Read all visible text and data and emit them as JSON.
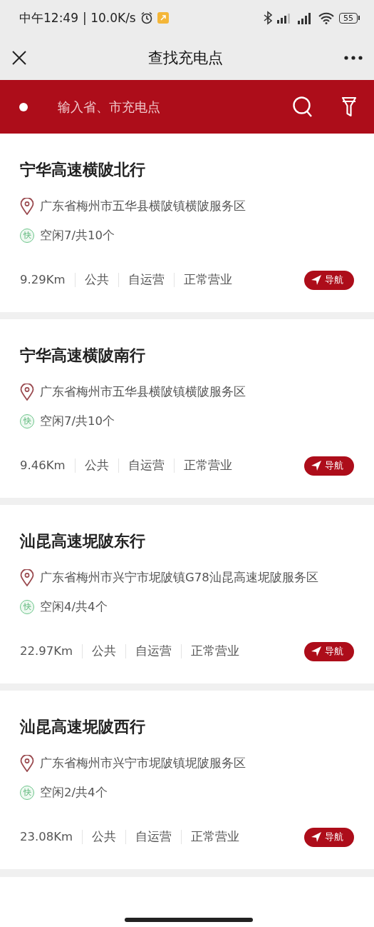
{
  "status_bar": {
    "time": "中午12:49",
    "speed": "| 10.0K/s",
    "battery": "55"
  },
  "header": {
    "title": "查找充电点"
  },
  "search": {
    "placeholder": "输入省、市充电点"
  },
  "stations": [
    {
      "name": "宁华高速横陂北行",
      "address": "广东省梅州市五华县横陂镇横陂服务区",
      "badge": "快",
      "availability": "空闲7/共10个",
      "distance": "9.29Km",
      "tags": [
        "公共",
        "自运营",
        "正常营业"
      ],
      "nav_label": "导航"
    },
    {
      "name": "宁华高速横陂南行",
      "address": "广东省梅州市五华县横陂镇横陂服务区",
      "badge": "快",
      "availability": "空闲7/共10个",
      "distance": "9.46Km",
      "tags": [
        "公共",
        "自运营",
        "正常营业"
      ],
      "nav_label": "导航"
    },
    {
      "name": "汕昆高速坭陂东行",
      "address": "广东省梅州市兴宁市坭陂镇G78汕昆高速坭陂服务区",
      "badge": "快",
      "availability": "空闲4/共4个",
      "distance": "22.97Km",
      "tags": [
        "公共",
        "自运营",
        "正常营业"
      ],
      "nav_label": "导航"
    },
    {
      "name": "汕昆高速坭陂西行",
      "address": "广东省梅州市兴宁市坭陂镇坭陂服务区",
      "badge": "快",
      "availability": "空闲2/共4个",
      "distance": "23.08Km",
      "tags": [
        "公共",
        "自运营",
        "正常营业"
      ],
      "nav_label": "导航"
    }
  ]
}
